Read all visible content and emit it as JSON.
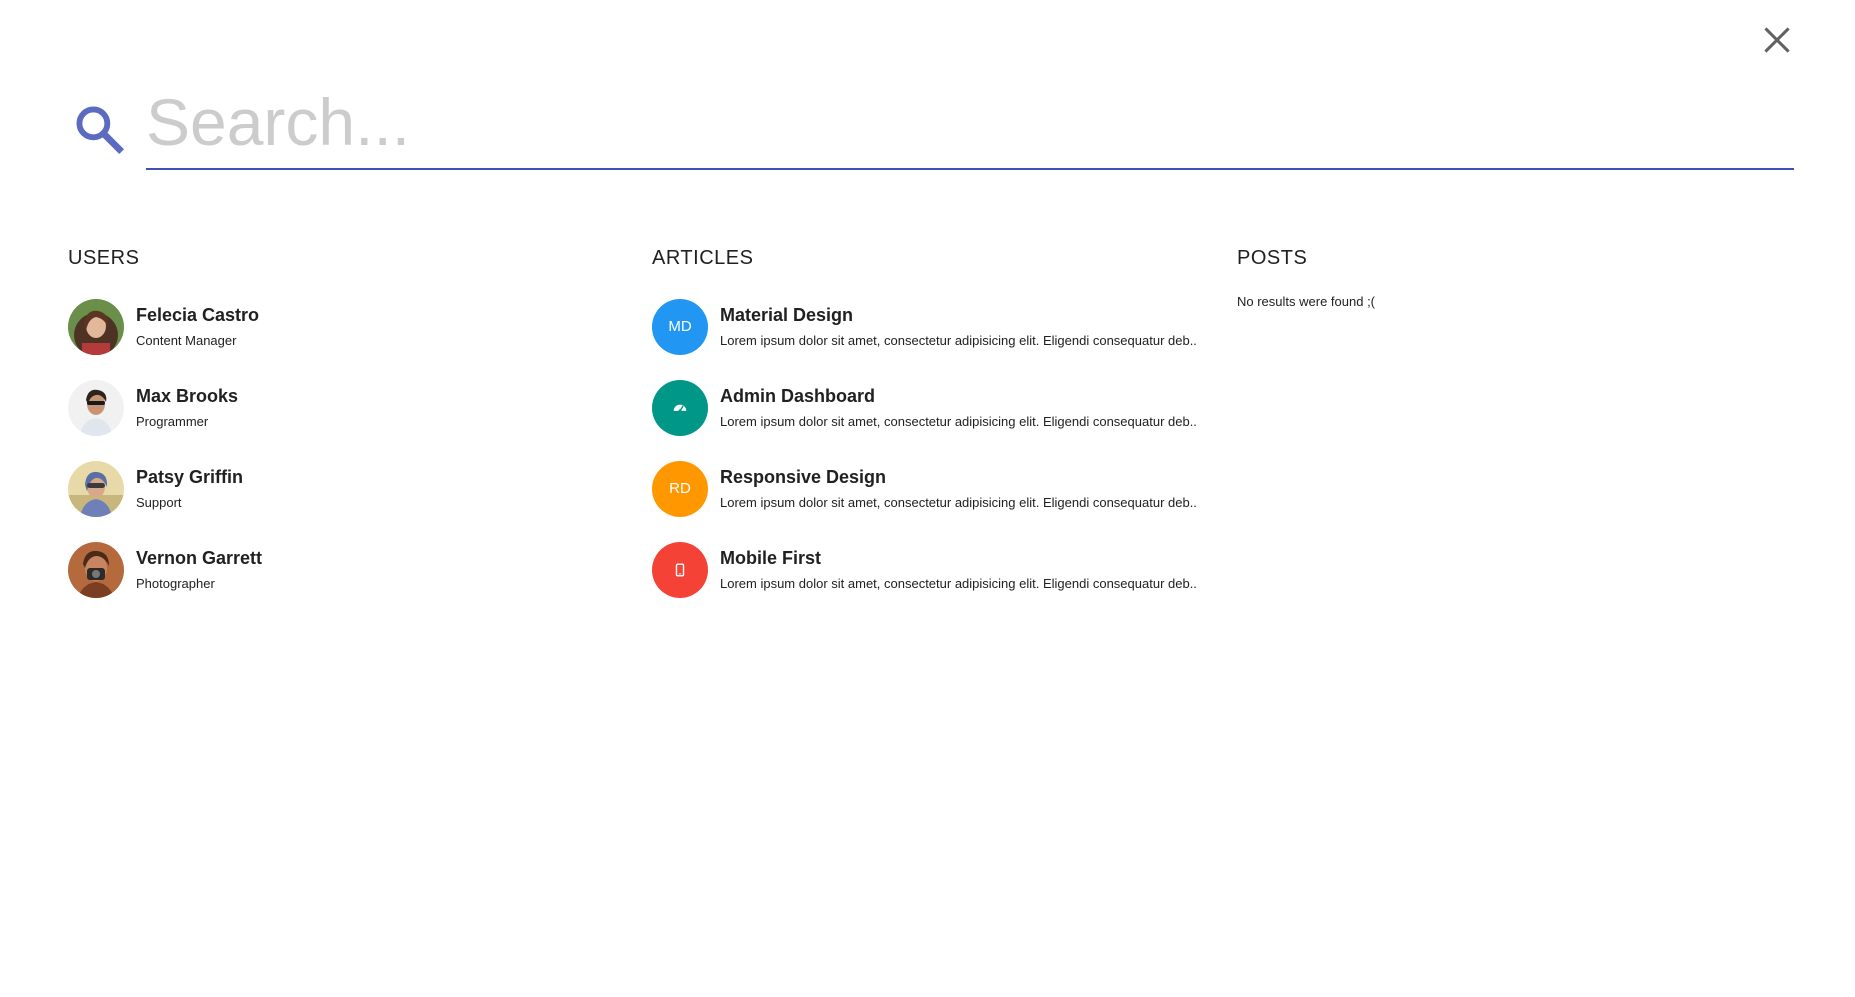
{
  "search": {
    "placeholder": "Search...",
    "value": ""
  },
  "colors": {
    "accent": "#3f51b5",
    "close": "#616161"
  },
  "users": {
    "title": "USERS",
    "items": [
      {
        "name": "Felecia Castro",
        "role": "Content Manager"
      },
      {
        "name": "Max Brooks",
        "role": "Programmer"
      },
      {
        "name": "Patsy Griffin",
        "role": "Support"
      },
      {
        "name": "Vernon Garrett",
        "role": "Photographer"
      }
    ]
  },
  "articles": {
    "title": "ARTICLES",
    "items": [
      {
        "title": "Material Design",
        "initials": "MD",
        "icon": "initials",
        "color": "#2196f3",
        "excerpt": "Lorem ipsum dolor sit amet, consectetur adipisicing elit. Eligendi consequatur deb.."
      },
      {
        "title": "Admin Dashboard",
        "initials": "",
        "icon": "dashboard-icon",
        "color": "#009688",
        "excerpt": "Lorem ipsum dolor sit amet, consectetur adipisicing elit. Eligendi consequatur deb.."
      },
      {
        "title": "Responsive Design",
        "initials": "RD",
        "icon": "initials",
        "color": "#ff9800",
        "excerpt": "Lorem ipsum dolor sit amet, consectetur adipisicing elit. Eligendi consequatur deb.."
      },
      {
        "title": "Mobile First",
        "initials": "",
        "icon": "phone-icon",
        "color": "#f44336",
        "excerpt": "Lorem ipsum dolor sit amet, consectetur adipisicing elit. Eligendi consequatur deb.."
      }
    ]
  },
  "posts": {
    "title": "POSTS",
    "empty_message": "No results were found ;("
  }
}
